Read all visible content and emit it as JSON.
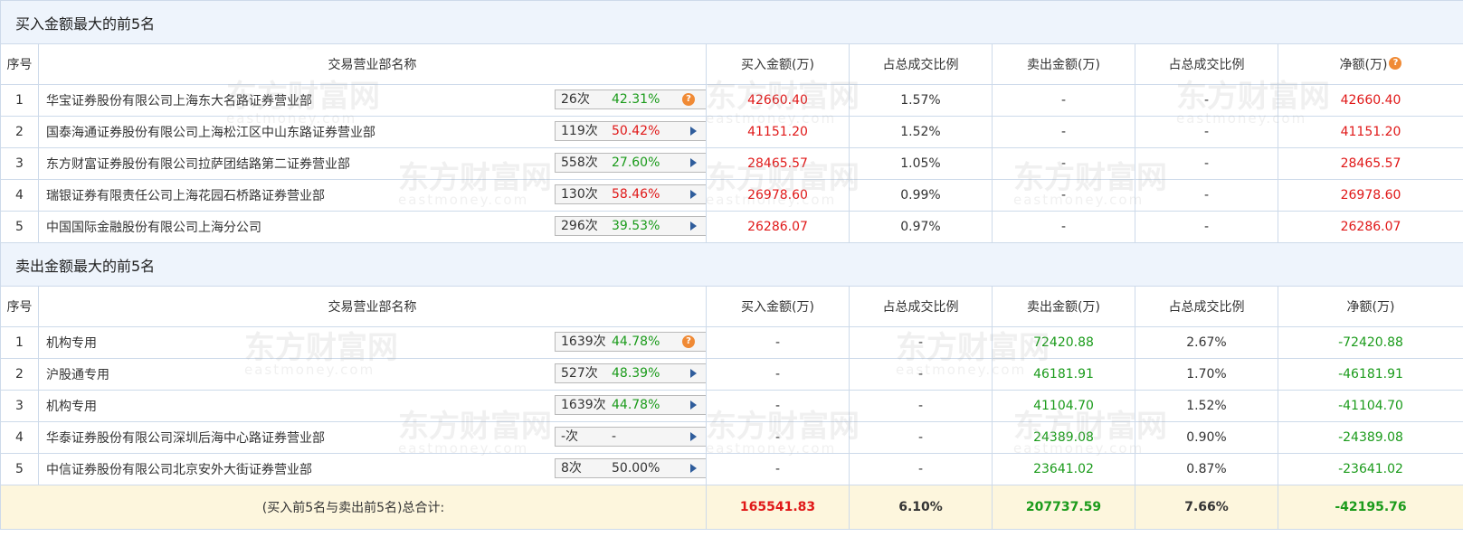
{
  "buy": {
    "title": "买入金额最大的前5名",
    "headers": {
      "rank": "序号",
      "name": "交易营业部名称",
      "buy_amount": "买入金额(万)",
      "buy_ratio": "占总成交比例",
      "sell_amount": "卖出金额(万)",
      "sell_ratio": "占总成交比例",
      "net": "净额(万)"
    },
    "help_icon": "question-circle-icon",
    "rows": [
      {
        "rank": "1",
        "name": "华宝证券股份有限公司上海东大名路证券营业部",
        "times": "26次",
        "pct": "42.31%",
        "pct_color": "green",
        "chip_icon": "question-circle-icon",
        "buy_amount": "42660.40",
        "buy_ratio": "1.57%",
        "sell_amount": "-",
        "sell_ratio": "-",
        "net": "42660.40"
      },
      {
        "rank": "2",
        "name": "国泰海通证券股份有限公司上海松江区中山东路证券营业部",
        "times": "119次",
        "pct": "50.42%",
        "pct_color": "red",
        "chip_icon": "arrow-right-icon",
        "buy_amount": "41151.20",
        "buy_ratio": "1.52%",
        "sell_amount": "-",
        "sell_ratio": "-",
        "net": "41151.20"
      },
      {
        "rank": "3",
        "name": "东方财富证券股份有限公司拉萨团结路第二证券营业部",
        "times": "558次",
        "pct": "27.60%",
        "pct_color": "green",
        "chip_icon": "arrow-right-icon",
        "buy_amount": "28465.57",
        "buy_ratio": "1.05%",
        "sell_amount": "-",
        "sell_ratio": "-",
        "net": "28465.57"
      },
      {
        "rank": "4",
        "name": "瑞银证券有限责任公司上海花园石桥路证券营业部",
        "times": "130次",
        "pct": "58.46%",
        "pct_color": "red",
        "chip_icon": "arrow-right-icon",
        "buy_amount": "26978.60",
        "buy_ratio": "0.99%",
        "sell_amount": "-",
        "sell_ratio": "-",
        "net": "26978.60"
      },
      {
        "rank": "5",
        "name": "中国国际金融股份有限公司上海分公司",
        "times": "296次",
        "pct": "39.53%",
        "pct_color": "green",
        "chip_icon": "arrow-right-icon",
        "buy_amount": "26286.07",
        "buy_ratio": "0.97%",
        "sell_amount": "-",
        "sell_ratio": "-",
        "net": "26286.07"
      }
    ]
  },
  "sell": {
    "title": "卖出金额最大的前5名",
    "headers": {
      "rank": "序号",
      "name": "交易营业部名称",
      "buy_amount": "买入金额(万)",
      "buy_ratio": "占总成交比例",
      "sell_amount": "卖出金额(万)",
      "sell_ratio": "占总成交比例",
      "net": "净额(万)"
    },
    "rows": [
      {
        "rank": "1",
        "name": "机构专用",
        "times": "1639次",
        "pct": "44.78%",
        "pct_color": "green",
        "chip_icon": "question-circle-icon",
        "buy_amount": "-",
        "buy_ratio": "-",
        "sell_amount": "72420.88",
        "sell_ratio": "2.67%",
        "net": "-72420.88"
      },
      {
        "rank": "2",
        "name": "沪股通专用",
        "times": "527次",
        "pct": "48.39%",
        "pct_color": "green",
        "chip_icon": "arrow-right-icon",
        "buy_amount": "-",
        "buy_ratio": "-",
        "sell_amount": "46181.91",
        "sell_ratio": "1.70%",
        "net": "-46181.91"
      },
      {
        "rank": "3",
        "name": "机构专用",
        "times": "1639次",
        "pct": "44.78%",
        "pct_color": "green",
        "chip_icon": "arrow-right-icon",
        "buy_amount": "-",
        "buy_ratio": "-",
        "sell_amount": "41104.70",
        "sell_ratio": "1.52%",
        "net": "-41104.70"
      },
      {
        "rank": "4",
        "name": "华泰证券股份有限公司深圳后海中心路证券营业部",
        "times": "-次",
        "pct": "-",
        "pct_color": "dark",
        "chip_icon": "arrow-right-icon",
        "buy_amount": "-",
        "buy_ratio": "-",
        "sell_amount": "24389.08",
        "sell_ratio": "0.90%",
        "net": "-24389.08"
      },
      {
        "rank": "5",
        "name": "中信证券股份有限公司北京安外大街证券营业部",
        "times": "8次",
        "pct": "50.00%",
        "pct_color": "dark",
        "chip_icon": "arrow-right-icon",
        "buy_amount": "-",
        "buy_ratio": "-",
        "sell_amount": "23641.02",
        "sell_ratio": "0.87%",
        "net": "-23641.02"
      }
    ]
  },
  "total": {
    "label": "(买入前5名与卖出前5名)总合计:",
    "buy_amount": "165541.83",
    "buy_ratio": "6.10%",
    "sell_amount": "207737.59",
    "sell_ratio": "7.66%",
    "net": "-42195.76"
  },
  "watermark": {
    "text": "东方财富网",
    "sub": "eastmoney.com"
  },
  "colors": {
    "red": "#e01818",
    "green": "#1b9b1b",
    "header_bg": "#eef4fc",
    "total_bg": "#fdf6dd",
    "border": "#cddaea",
    "icon_orange": "#f08a35",
    "arrow_blue": "#2f5d9c"
  }
}
